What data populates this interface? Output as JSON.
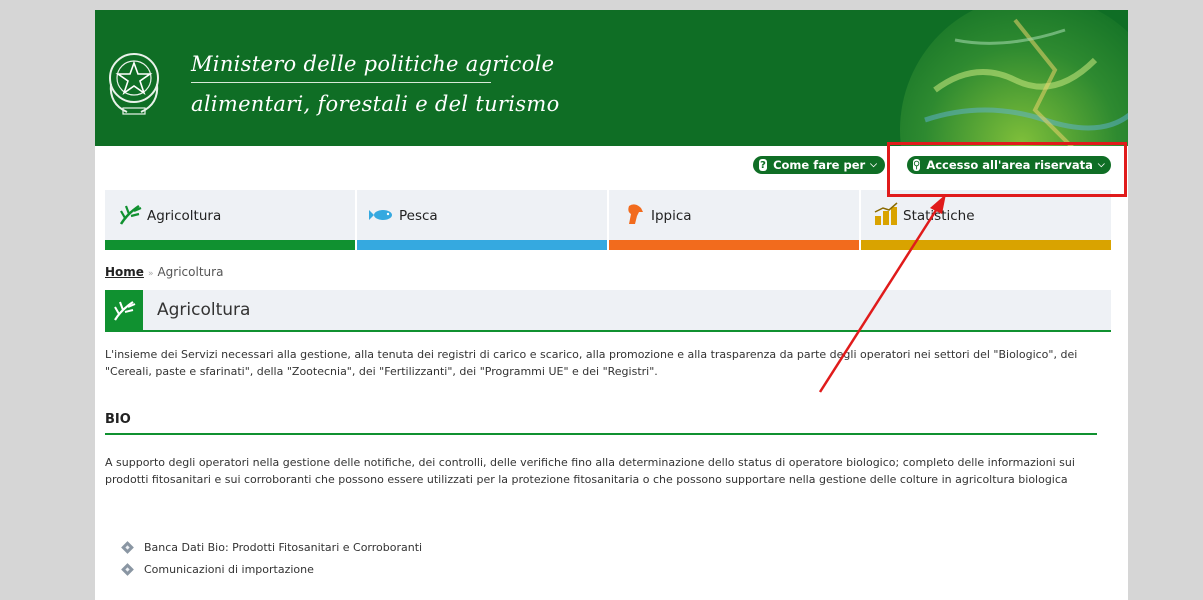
{
  "header": {
    "ministry_line1": "Ministero delle politiche agricole",
    "ministry_line2": "alimentari, forestali e del turismo",
    "brand_color": "#0f6e25"
  },
  "topbar": {
    "come_fare_label": "Come fare per",
    "accesso_label": "Accesso all'area riservata"
  },
  "tabs": [
    {
      "label": "Agricoltura",
      "color": "#109130",
      "icon": "wheat-icon"
    },
    {
      "label": "Pesca",
      "color": "#35a9e0",
      "icon": "fish-icon"
    },
    {
      "label": "Ippica",
      "color": "#f26b1d",
      "icon": "horse-icon"
    },
    {
      "label": "Statistiche",
      "color": "#d9a300",
      "icon": "chart-icon"
    }
  ],
  "breadcrumb": {
    "home": "Home",
    "current": "Agricoltura"
  },
  "section": {
    "title": "Agricoltura",
    "intro": "L'insieme dei Servizi necessari alla gestione, alla tenuta dei registri di carico e scarico, alla promozione e alla trasparenza da parte degli operatori nei settori del \"Biologico\", dei \"Cereali, paste e sfarinati\", della \"Zootecnia\", dei \"Fertilizzanti\", dei \"Programmi UE\" e dei \"Registri\"."
  },
  "bio": {
    "heading": "BIO",
    "description": "A supporto degli operatori nella gestione delle notifiche, dei controlli, delle verifiche fino alla determinazione dello status di operatore biologico; completo delle informazioni sui prodotti fitosanitari e sui corroboranti che possono essere utilizzati per la protezione fitosanitaria o che possono supportare nella gestione delle colture in agricoltura biologica",
    "links": [
      "Banca Dati Bio: Prodotti Fitosanitari e Corroboranti",
      "Comunicazioni di importazione"
    ]
  },
  "annotation": {
    "highlight_color": "#e01b1b"
  }
}
